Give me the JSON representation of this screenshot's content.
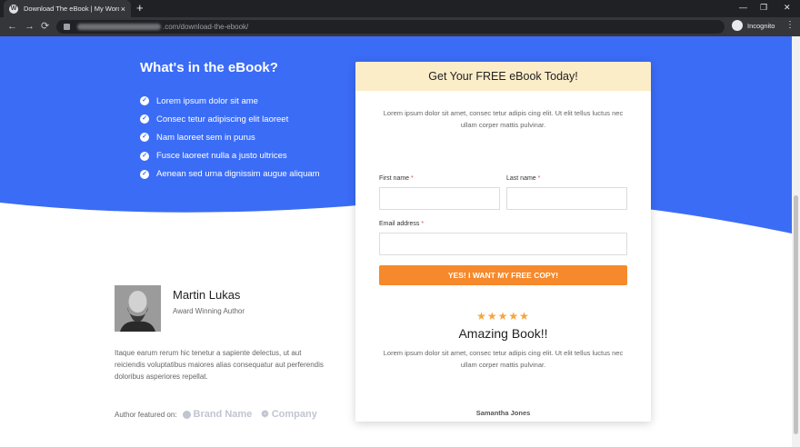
{
  "browser": {
    "tab_title": "Download The eBook | My WordPress",
    "tab_close": "×",
    "new_tab": "+",
    "url_path": ".com/download-the-ebook/",
    "incognito_label": "Incognito",
    "controls": {
      "minimize": "—",
      "restore": "❐",
      "close": "✕",
      "back": "←",
      "forward": "→",
      "reload": "⟳",
      "menu": "⋮"
    }
  },
  "hero": {
    "title": "What's in the eBook?",
    "accent_color": "#3b6cf6",
    "items": [
      "Lorem ipsum dolor sit ame",
      "Consec tetur adipiscing elit laoreet",
      "Nam laoreet sem in purus",
      "Fusce laoreet nulla a justo ultrices",
      "Aenean sed urna dignissim augue aliquam"
    ]
  },
  "form_card": {
    "heading": "Get Your FREE eBook Today!",
    "description": "Lorem ipsum dolor sit amet, consec tetur adipis cing elit. Ut elit tellus luctus nec ullam corper mattis pulvinar.",
    "first_name_label": "First name",
    "last_name_label": "Last name",
    "email_label": "Email address",
    "required_mark": "*",
    "first_name_value": "",
    "last_name_value": "",
    "email_value": "",
    "submit_label": "YES! I WANT MY FREE COPY!",
    "button_color": "#f6892b"
  },
  "review": {
    "stars": "★★★★★",
    "rating": 5,
    "title": "Amazing Book!!",
    "text": "Lorem ipsum dolor sit amet, consec tetur adipis cing elit. Ut elit tellus luctus nec ullam corper mattis pulvinar.",
    "reviewer": "Samantha Jones"
  },
  "author": {
    "name": "Martin Lukas",
    "role": "Award Winning Author",
    "bio": "Itaque earum rerum hic tenetur a sapiente delectus, ut aut reiciendis voluptatibus maiores alias consequatur aut perferendis doloribus asperiores repellat.",
    "featured_label": "Author featured on:",
    "brands": [
      "Brand Name",
      "Company"
    ]
  }
}
